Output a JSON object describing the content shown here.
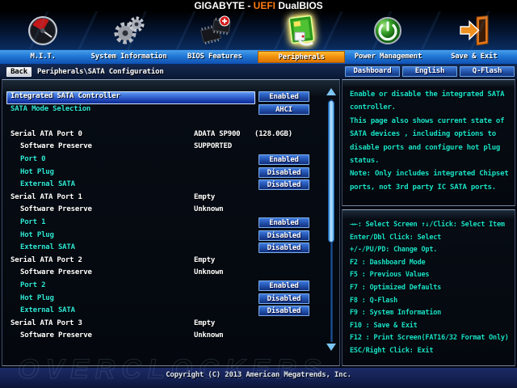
{
  "window": {
    "title_prefix": "GIGABYTE - ",
    "title_accent": "UEFI",
    "title_suffix": " DualBIOS"
  },
  "tabs": [
    {
      "label": "M.I.T.",
      "icon": "gauge-icon",
      "active": false
    },
    {
      "label": "System Information",
      "icon": "gears-icon",
      "active": false
    },
    {
      "label": "BIOS Features",
      "icon": "chips-icon",
      "active": false
    },
    {
      "label": "Peripherals",
      "icon": "peripheral-card-icon",
      "active": true
    },
    {
      "label": "Power Management",
      "icon": "power-icon",
      "active": false
    },
    {
      "label": "Save & Exit",
      "icon": "exit-door-icon",
      "active": false
    }
  ],
  "breadcrumb": {
    "back_label": "Back",
    "path": "Peripherals\\SATA Configuration"
  },
  "quick_buttons": [
    {
      "label": "Dashboard"
    },
    {
      "label": "English"
    },
    {
      "label": "Q-Flash"
    }
  ],
  "main": {
    "rows": [
      {
        "label": "Integrated SATA Controller",
        "control": "button",
        "value": "Enabled",
        "selected": true
      },
      {
        "label": "SATA Mode Selection",
        "accent": true,
        "control": "button",
        "value": "AHCI"
      },
      {
        "spacer": true,
        "label": "",
        "control": "none"
      },
      {
        "label": "Serial ATA Port 0",
        "control": "text",
        "value": "ADATA SP900",
        "value2": "(128.0GB)"
      },
      {
        "label": "Software Preserve",
        "indent": true,
        "control": "text",
        "value": "SUPPORTED"
      },
      {
        "label": "Port 0",
        "indent": true,
        "accent": true,
        "control": "button",
        "value": "Enabled"
      },
      {
        "label": "Hot Plug",
        "indent": true,
        "accent": true,
        "control": "button",
        "value": "Disabled"
      },
      {
        "label": "External SATA",
        "indent": true,
        "accent": true,
        "control": "button",
        "value": "Disabled"
      },
      {
        "label": "Serial ATA Port 1",
        "control": "text",
        "value": "Empty"
      },
      {
        "label": "Software Preserve",
        "indent": true,
        "control": "text",
        "value": "Unknown"
      },
      {
        "label": "Port 1",
        "indent": true,
        "accent": true,
        "control": "button",
        "value": "Enabled"
      },
      {
        "label": "Hot Plug",
        "indent": true,
        "accent": true,
        "control": "button",
        "value": "Disabled"
      },
      {
        "label": "External SATA",
        "indent": true,
        "accent": true,
        "control": "button",
        "value": "Disabled"
      },
      {
        "label": "Serial ATA Port 2",
        "control": "text",
        "value": "Empty"
      },
      {
        "label": "Software Preserve",
        "indent": true,
        "control": "text",
        "value": "Unknown"
      },
      {
        "label": "Port 2",
        "indent": true,
        "accent": true,
        "control": "button",
        "value": "Enabled"
      },
      {
        "label": "Hot Plug",
        "indent": true,
        "accent": true,
        "control": "button",
        "value": "Disabled"
      },
      {
        "label": "External SATA",
        "indent": true,
        "accent": true,
        "control": "button",
        "value": "Disabled"
      },
      {
        "label": "Serial ATA Port 3",
        "control": "text",
        "value": "Empty"
      },
      {
        "label": "Software Preserve",
        "indent": true,
        "control": "text",
        "value": "Unknown"
      }
    ]
  },
  "help": {
    "paragraphs": [
      "Enable or disable the integrated SATA controller.",
      "This page also shows current state of SATA devices , including options to disable ports and configure hot plug status.",
      "Note: Only includes integrated Chipset ports, not 3rd party IC SATA ports."
    ]
  },
  "keys": {
    "lines": [
      {
        "text": "→←: Select Screen  ↑↓/Click: Select Item"
      },
      {
        "text": "Enter/Dbl Click: Select"
      },
      {
        "text": "+/-/PU/PD: Change Opt."
      },
      {
        "text": "F2  : Dashboard Mode"
      },
      {
        "text": "F5  : Previous Values"
      },
      {
        "text": "F7  : Optimized Defaults"
      },
      {
        "text": "F8  : Q-Flash"
      },
      {
        "text": "F9  : System Information"
      },
      {
        "text": "F10 : Save & Exit"
      },
      {
        "text": "F12 : Print Screen(FAT16/32 Format Only)"
      },
      {
        "text": "ESC/Right Click: Exit"
      }
    ]
  },
  "footer": {
    "copyright": "Copyright (C) 2013 American Megatrends, Inc."
  },
  "watermark": {
    "text": "OVERCLOCKERS"
  },
  "colors": {
    "tab_active_orange": "#f2920e",
    "tab_bar_blue": "#2277d4",
    "option_cyan": "#2fe8d6",
    "help_teal": "#19e2c8",
    "button_blue": "#2557b4",
    "title_accent_orange": "#ff7b10"
  }
}
